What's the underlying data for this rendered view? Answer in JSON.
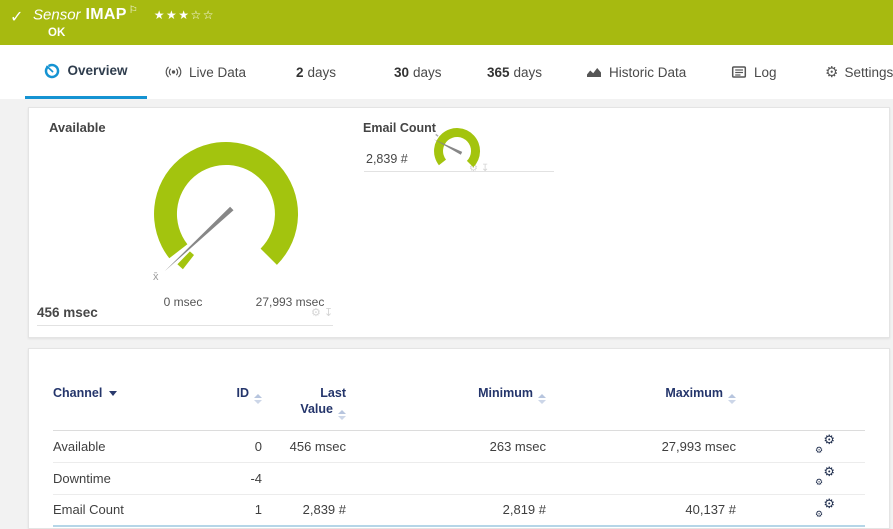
{
  "banner": {
    "check": "✓",
    "sensor_label": "Sensor",
    "sensor_name": "IMAP",
    "flag": "⚐",
    "stars_filled": "★★★",
    "stars_empty": "☆☆",
    "status": "OK"
  },
  "tabs": {
    "overview": "Overview",
    "live_data": "Live Data",
    "d2_num": "2",
    "d2_label": "days",
    "d30_num": "30",
    "d30_label": "days",
    "d365_num": "365",
    "d365_label": "days",
    "historic": "Historic Data",
    "log": "Log",
    "settings": "Settings"
  },
  "gauges": {
    "available": {
      "title": "Available",
      "value": "456 msec",
      "scale_min": "0 msec",
      "scale_max": "27,993 msec",
      "avg_marker": "x̄"
    },
    "email_count": {
      "title": "Email Count",
      "value": "2,839 #"
    }
  },
  "table": {
    "headers": {
      "channel": "Channel",
      "id": "ID",
      "last_value_line1": "Last",
      "last_value_line2": "Value",
      "minimum": "Minimum",
      "maximum": "Maximum"
    },
    "rows": [
      {
        "channel": "Available",
        "id": "0",
        "last_value": "456 msec",
        "minimum": "263 msec",
        "maximum": "27,993 msec"
      },
      {
        "channel": "Downtime",
        "id": "-4",
        "last_value": "",
        "minimum": "",
        "maximum": ""
      },
      {
        "channel": "Email Count",
        "id": "1",
        "last_value": "2,839 #",
        "minimum": "2,819 #",
        "maximum": "40,137 #"
      }
    ]
  },
  "icons": {
    "gear": "⚙",
    "pin": "↧"
  },
  "colors": {
    "banner_green": "#a7ba10",
    "gauge_green": "#a3c40e",
    "accent_blue": "#1593d2",
    "header_navy": "#24356b"
  }
}
